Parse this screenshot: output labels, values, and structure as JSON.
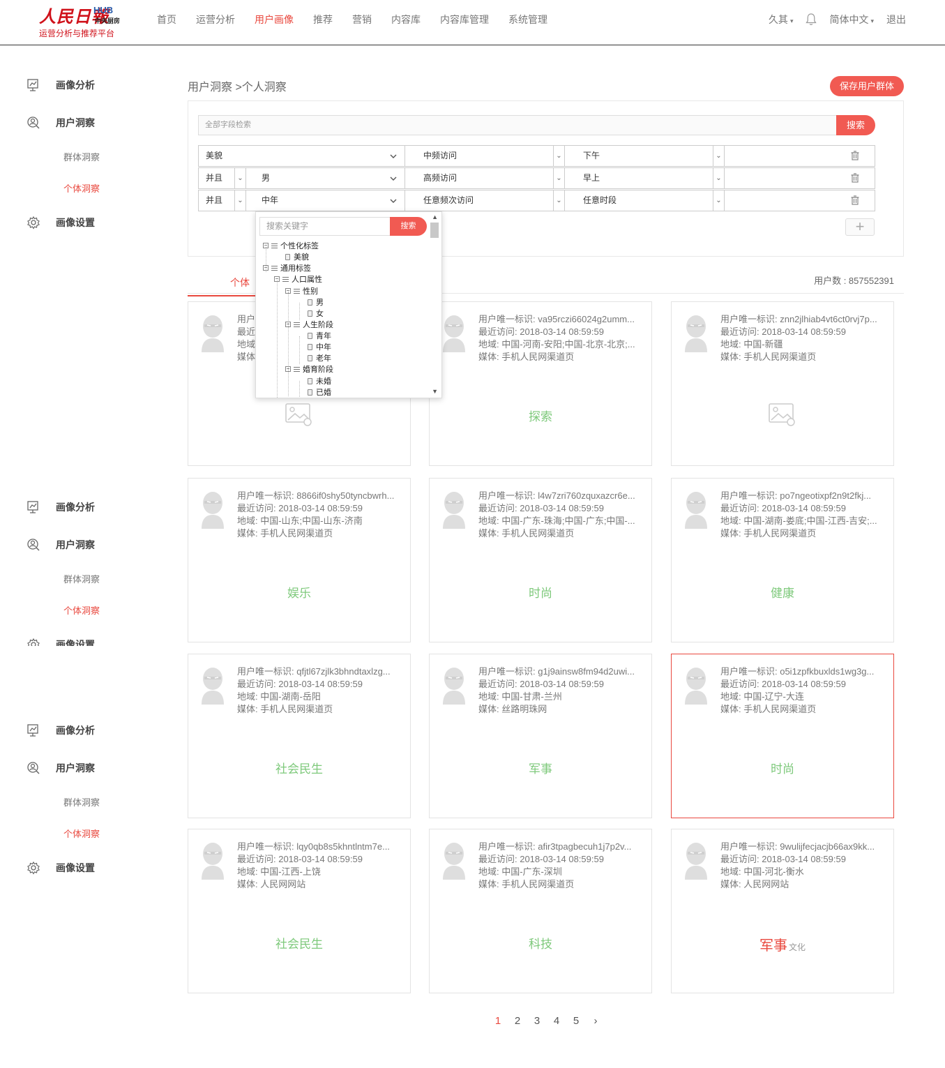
{
  "logo": {
    "main": "人民日報",
    "hub": "HUB",
    "hub_sub": "中央厨房",
    "subtitle": "运营分析与推荐平台"
  },
  "nav": [
    "首页",
    "运营分析",
    "用户画像",
    "推荐",
    "营销",
    "内容库",
    "内容库管理",
    "系统管理"
  ],
  "nav_active_index": 2,
  "header_right": {
    "user": "久其",
    "language": "简体中文",
    "logout": "退出"
  },
  "sidebar": {
    "portrait_analysis": "画像分析",
    "user_insight": "用户洞察",
    "group_insight": "群体洞察",
    "individual_insight": "个体洞察",
    "portrait_settings": "画像设置"
  },
  "breadcrumb": "用户洞察 >个人洞察",
  "save_button": "保存用户群体",
  "search": {
    "placeholder": "全部字段检索",
    "button": "搜索"
  },
  "filters": [
    {
      "logic": "",
      "tag": "美貌",
      "frequency": "中频访问",
      "period": "下午"
    },
    {
      "logic": "并且",
      "tag": "男",
      "frequency": "高频访问",
      "period": "早上"
    },
    {
      "logic": "并且",
      "tag": "中年",
      "frequency": "任意频次访问",
      "period": "任意时段"
    }
  ],
  "tree_dropdown": {
    "placeholder": "搜索关键字",
    "button": "搜索",
    "nodes": [
      "个性化标签",
      "美貌",
      "通用标签",
      "人口属性",
      "性别",
      "男",
      "女",
      "人生阶段",
      "青年",
      "中年",
      "老年",
      "婚育阶段",
      "未婚",
      "已婚"
    ]
  },
  "tab_active": "个体",
  "user_count": "用户数 : 857552391",
  "cards": [
    {
      "id": "用户唯一标识: ",
      "last": "最近访问: 2018-03-14 08:59:59",
      "region": "地域: ",
      "media": "媒体: ",
      "tag": "",
      "image": true
    },
    {
      "id": "用户唯一标识: va95rczi66024g2umm...",
      "last": "最近访问: 2018-03-14 08:59:59",
      "region": "地域: 中国-河南-安阳;中国-北京-北京;...",
      "media": "媒体: 手机人民网渠道页",
      "tag": "探索"
    },
    {
      "id": "用户唯一标识: znn2jlhiab4vt6ct0rvj7p...",
      "last": "最近访问: 2018-03-14 08:59:59",
      "region": "地域: 中国-新疆",
      "media": "媒体: 手机人民网渠道页",
      "tag": "",
      "image": true
    },
    {
      "id": "用户唯一标识: 8866if0shy50tyncbwrh...",
      "last": "最近访问: 2018-03-14 08:59:59",
      "region": "地域: 中国-山东;中国-山东-济南",
      "media": "媒体: 手机人民网渠道页",
      "tag": "娱乐"
    },
    {
      "id": "用户唯一标识: l4w7zri760zquxazcr6e...",
      "last": "最近访问: 2018-03-14 08:59:59",
      "region": "地域: 中国-广东-珠海;中国-广东;中国-...",
      "media": "媒体: 手机人民网渠道页",
      "tag": "时尚"
    },
    {
      "id": "用户唯一标识: po7ngeotixpf2n9t2fkj...",
      "last": "最近访问: 2018-03-14 08:59:59",
      "region": "地域: 中国-湖南-娄底;中国-江西-吉安;...",
      "media": "媒体: 手机人民网渠道页",
      "tag": "健康"
    },
    {
      "id": "用户唯一标识: qfjtl67zjlk3bhndtaxlzg...",
      "last": "最近访问: 2018-03-14 08:59:59",
      "region": "地域: 中国-湖南-岳阳",
      "media": "媒体: 手机人民网渠道页",
      "tag": "社会民生"
    },
    {
      "id": "用户唯一标识: g1j9ainsw8fm94d2uwi...",
      "last": "最近访问: 2018-03-14 08:59:59",
      "region": "地域: 中国-甘肃-兰州",
      "media": "媒体: 丝路明珠网",
      "tag": "军事"
    },
    {
      "id": "用户唯一标识: o5i1zpfkbuxlds1wg3g...",
      "last": "最近访问: 2018-03-14 08:59:59",
      "region": "地域: 中国-辽宁-大连",
      "media": "媒体: 手机人民网渠道页",
      "tag": "时尚",
      "selected": true
    },
    {
      "id": "用户唯一标识: lqy0qb8s5khntlntm7e...",
      "last": "最近访问: 2018-03-14 08:59:59",
      "region": "地域: 中国-江西-上饶",
      "media": "媒体: 人民网网站",
      "tag": "社会民生"
    },
    {
      "id": "用户唯一标识: afir3tpagbecuh1j7p2v...",
      "last": "最近访问: 2018-03-14 08:59:59",
      "region": "地域: 中国-广东-深圳",
      "media": "媒体: 手机人民网渠道页",
      "tag": "科技"
    },
    {
      "id": "用户唯一标识: 9wulijfecjacjb66ax9kk...",
      "last": "最近访问: 2018-03-14 08:59:59",
      "region": "地域: 中国-河北-衡水",
      "media": "媒体: 人民网网站",
      "tag": "军事",
      "tag2": "文化"
    }
  ],
  "pagination": [
    "1",
    "2",
    "3",
    "4",
    "5"
  ],
  "pagination_active": "1",
  "colors": {
    "accent": "#e9483e",
    "button": "#f15a52",
    "tag_green": "#7ec97b"
  }
}
